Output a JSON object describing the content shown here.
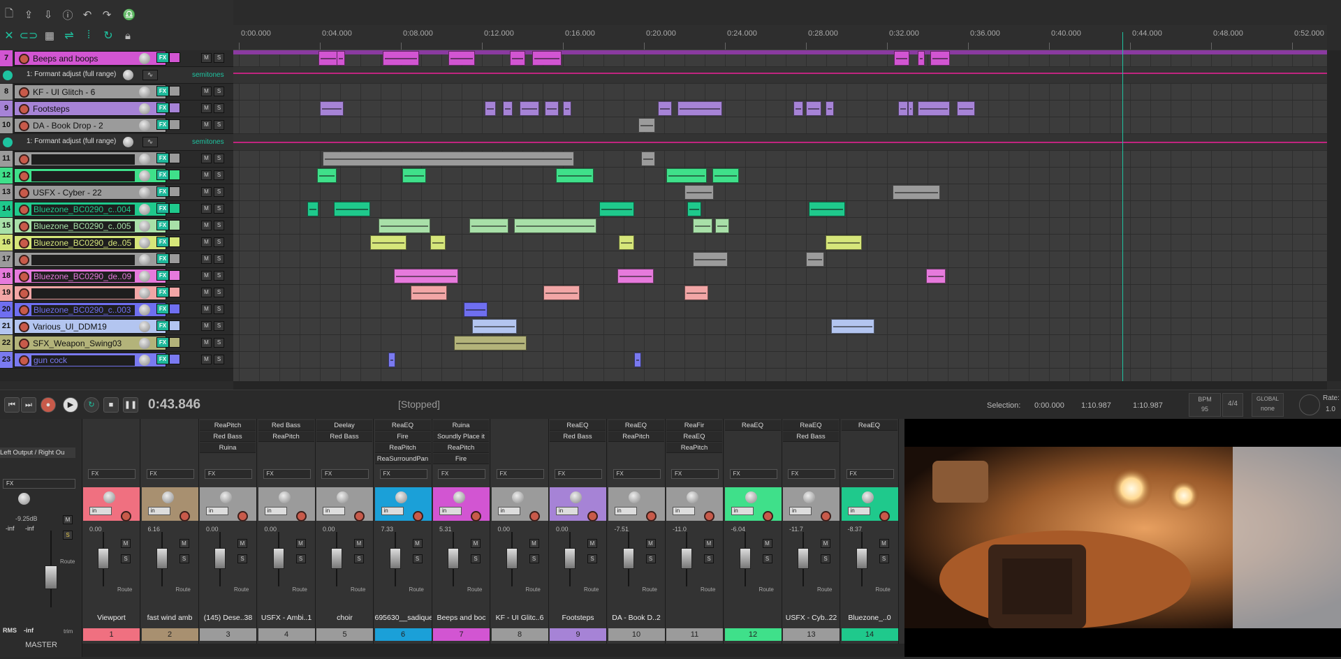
{
  "toolbar": {
    "icons_row1": [
      "new-file-icon",
      "open-icon",
      "save-icon",
      "info-icon",
      "undo-icon",
      "redo-icon",
      "metronome-icon"
    ],
    "icons_row2": [
      "ripple-icon",
      "link-icon",
      "grid-icon",
      "snap-icon",
      "envelope-icon",
      "loop-icon",
      "lock-icon"
    ]
  },
  "ruler": {
    "ticks": [
      "0:00.000",
      "0:04.000",
      "0:08.000",
      "0:12.000",
      "0:16.000",
      "0:20.000",
      "0:24.000",
      "0:28.000",
      "0:32.000",
      "0:36.000",
      "0:40.000",
      "0:44.000",
      "0:48.000",
      "0:52.000"
    ]
  },
  "tracks": [
    {
      "num": "7",
      "name": "Beeps and boops",
      "color": "#d255d2",
      "dark": false
    },
    {
      "num": "8",
      "name": "KF - UI Glitch - 6",
      "color": "#9b9b9b",
      "dark": false
    },
    {
      "num": "9",
      "name": "Footsteps",
      "color": "#a683d6",
      "dark": false
    },
    {
      "num": "10",
      "name": "DA - Book Drop - 2",
      "color": "#9b9b9b",
      "dark": false
    },
    {
      "num": "11",
      "name": "",
      "color": "#9b9b9b",
      "dark": true
    },
    {
      "num": "12",
      "name": "",
      "color": "#3fe08a",
      "dark": true
    },
    {
      "num": "13",
      "name": "USFX - Cyber - 22",
      "color": "#9b9b9b",
      "dark": false
    },
    {
      "num": "14",
      "name": "Bluezone_BC0290_c..004",
      "color": "#1fc98c",
      "dark": true
    },
    {
      "num": "15",
      "name": "Bluezone_BC0290_c..005",
      "color": "#a8e0a8",
      "dark": true
    },
    {
      "num": "16",
      "name": "Bluezone_BC0290_de..05",
      "color": "#d6e67a",
      "dark": true
    },
    {
      "num": "17",
      "name": "",
      "color": "#9b9b9b",
      "dark": true
    },
    {
      "num": "18",
      "name": "Bluezone_BC0290_de..09",
      "color": "#e67adc",
      "dark": true
    },
    {
      "num": "19",
      "name": "",
      "color": "#f2a6a6",
      "dark": true
    },
    {
      "num": "20",
      "name": "Bluezone_BC0290_c..003",
      "color": "#6f6ff0",
      "dark": true
    },
    {
      "num": "21",
      "name": "Various_UI_DDM19",
      "color": "#b3c5f0",
      "dark": false
    },
    {
      "num": "22",
      "name": "SFX_Weapon_Swing03",
      "color": "#b3b37a",
      "dark": false
    },
    {
      "num": "23",
      "name": "gun cock",
      "color": "#7a7af0",
      "dark": true
    }
  ],
  "envelopes": {
    "label": "1: Formant adjust (full range)",
    "unit": "semitones"
  },
  "transport": {
    "time": "0:43.846",
    "state": "[Stopped]",
    "selection_label": "Selection:",
    "sel_start": "0:00.000",
    "sel_end": "1:10.987",
    "sel_len": "1:10.987",
    "bpm_label": "BPM",
    "bpm": "95",
    "timesig": "4/4",
    "global_label": "GLOBAL",
    "global_value": "none",
    "rate_label": "Rate:",
    "rate": "1.0"
  },
  "master": {
    "output": "Left Output / Right Ou",
    "vol": "-9.25dB",
    "peak_l": "-inf",
    "peak_r": "-inf",
    "rms": "RMS",
    "rms_val": "-inf",
    "name": "MASTER",
    "fx": "FX",
    "trim": "trim",
    "route": "Route"
  },
  "strips": [
    {
      "idx": "1",
      "name": "Viewport",
      "color": "#f07080",
      "vol": "0.00",
      "fx": []
    },
    {
      "idx": "2",
      "name": "fast wind amb",
      "color": "#a89070",
      "vol": "6.16",
      "fx": []
    },
    {
      "idx": "3",
      "name": "(145) Dese..38",
      "color": "#9b9b9b",
      "vol": "0.00",
      "fx": [
        "ReaPitch",
        "Red Bass",
        "Ruina"
      ]
    },
    {
      "idx": "4",
      "name": "USFX - Ambi..1",
      "color": "#9b9b9b",
      "vol": "0.00",
      "fx": [
        "Red Bass",
        "ReaPitch"
      ]
    },
    {
      "idx": "5",
      "name": "choir",
      "color": "#9b9b9b",
      "vol": "0.00",
      "fx": [
        "Deelay",
        "Red Bass"
      ]
    },
    {
      "idx": "6",
      "name": "695630__sadiquec",
      "color": "#1ba0d8",
      "vol": "7.33",
      "fx": [
        "ReaEQ",
        "Fire",
        "ReaPitch",
        "ReaSurroundPan"
      ]
    },
    {
      "idx": "7",
      "name": "Beeps and boc",
      "color": "#d255d2",
      "vol": "5.31",
      "fx": [
        "Ruina",
        "Soundly Place it",
        "ReaPitch",
        "Fire"
      ]
    },
    {
      "idx": "8",
      "name": "KF - UI Glitc..6",
      "color": "#9b9b9b",
      "vol": "0.00",
      "fx": []
    },
    {
      "idx": "9",
      "name": "Footsteps",
      "color": "#a683d6",
      "vol": "0.00",
      "fx": [
        "ReaEQ",
        "Red Bass"
      ]
    },
    {
      "idx": "10",
      "name": "DA - Book D..2",
      "color": "#9b9b9b",
      "vol": "-7.51",
      "fx": [
        "ReaEQ",
        "ReaPitch"
      ]
    },
    {
      "idx": "11",
      "name": "",
      "color": "#9b9b9b",
      "vol": "-11.0",
      "fx": [
        "ReaFir",
        "ReaEQ",
        "ReaPitch"
      ]
    },
    {
      "idx": "12",
      "name": "",
      "color": "#3fe08a",
      "vol": "-6.04",
      "fx": [
        "ReaEQ"
      ]
    },
    {
      "idx": "13",
      "name": "USFX - Cyb..22",
      "color": "#9b9b9b",
      "vol": "-11.7",
      "fx": [
        "ReaEQ",
        "Red Bass"
      ]
    },
    {
      "idx": "14",
      "name": "Bluezone_..0",
      "color": "#1fc98c",
      "vol": "-8.37",
      "fx": [
        "ReaEQ"
      ]
    }
  ],
  "strip_labels": {
    "fx": "FX",
    "in": "in",
    "m": "M",
    "s": "S",
    "route": "Route"
  },
  "colors": {
    "accent": "#1ec3a0",
    "envelope": "#c0257f",
    "playhead": "#1ec3a0"
  }
}
